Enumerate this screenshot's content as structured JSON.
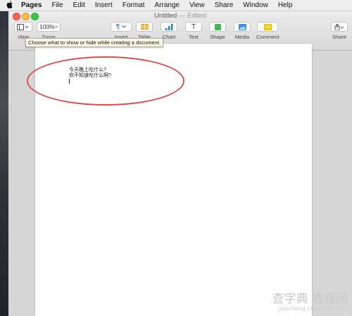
{
  "menubar": {
    "app_name": "Pages",
    "items": [
      "File",
      "Edit",
      "Insert",
      "Format",
      "Arrange",
      "View",
      "Share",
      "Window",
      "Help"
    ]
  },
  "window": {
    "title": "Untitled",
    "title_separator": "—",
    "title_status": "Edited"
  },
  "toolbar": {
    "view_label": "View",
    "zoom_value": "100%",
    "zoom_label": "Zoom",
    "insert_label": "Insert",
    "table_label": "Table",
    "chart_label": "Chart",
    "text_label": "Text",
    "shape_label": "Shape",
    "media_label": "Media",
    "comment_label": "Comment",
    "share_label": "Share",
    "insert_glyph": "¶",
    "text_glyph": "T"
  },
  "tooltip": {
    "text": "Choose what to show or hide while creating a document."
  },
  "document": {
    "lines": [
      "今天晚上吃什么?",
      "你不知道吃什么啊?"
    ]
  },
  "watermark": {
    "main": "查字典 教程网",
    "sub": "jiaocheng.chazidian.com"
  },
  "colors": {
    "annotation": "#e24a4a",
    "close": "#fc605b",
    "minimize": "#fdbc40",
    "zoom": "#34c84a",
    "table_icon": "#f5a623",
    "chart_icon": "#1f7fe0",
    "shape_icon": "#3dbb4e",
    "media_icon": "#3d8fe0",
    "comment_icon": "#f5c400"
  }
}
